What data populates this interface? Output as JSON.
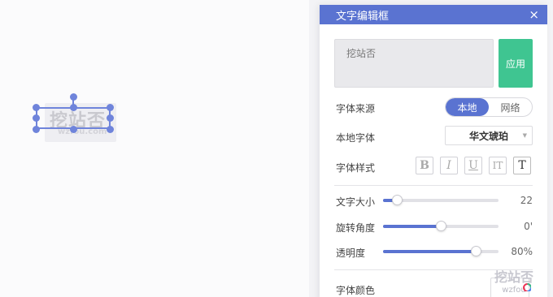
{
  "canvas": {
    "watermark_text": "挖站否",
    "watermark_sub": "wzfou.com"
  },
  "panel": {
    "title": "文字编辑框",
    "close_icon": "×",
    "text_value": "挖站否",
    "apply_label": "应用",
    "font_source_label": "字体来源",
    "font_source_options": [
      "本地",
      "网络"
    ],
    "font_source_selected": "本地",
    "local_font_label": "本地字体",
    "local_font_value": "华文琥珀",
    "font_style_label": "字体样式",
    "style_buttons": [
      "B",
      "I",
      "U",
      "IT",
      "T"
    ],
    "text_size_label": "文字大小",
    "text_size_value": "22",
    "text_size_fraction": 0.12,
    "rotation_label": "旋转角度",
    "rotation_value": "0'",
    "rotation_fraction": 0.5,
    "opacity_label": "透明度",
    "opacity_value": "80%",
    "opacity_fraction": 0.8,
    "color_label": "字体颜色"
  },
  "corner_watermark": {
    "big": "挖站否",
    "small": "wzfou"
  },
  "colors": {
    "accent": "#5a73d1",
    "apply": "#3fc591",
    "selection": "#6f84db"
  }
}
